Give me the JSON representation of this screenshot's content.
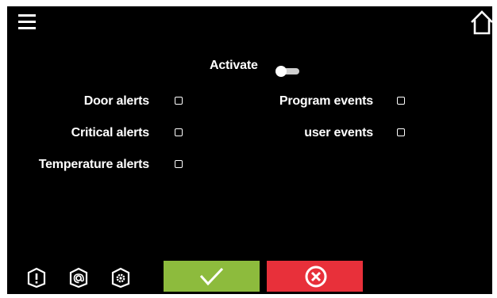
{
  "header": {
    "menu_icon": "hamburger-menu-icon",
    "home_icon": "home-icon"
  },
  "activate": {
    "label": "Activate",
    "state": "off"
  },
  "left_options": [
    {
      "label": "Door alerts",
      "checked": false
    },
    {
      "label": "Critical alerts",
      "checked": false
    },
    {
      "label": "Temperature alerts",
      "checked": false
    }
  ],
  "right_options": [
    {
      "label": "Program events",
      "checked": false
    },
    {
      "label": "user events",
      "checked": false
    }
  ],
  "bottom_icons": [
    "alert-info-icon",
    "email-icon",
    "settings-icon"
  ],
  "buttons": {
    "confirm_icon": "checkmark-icon",
    "confirm_color": "#8dbb3d",
    "cancel_icon": "cancel-x-icon",
    "cancel_color": "#e8303a"
  }
}
